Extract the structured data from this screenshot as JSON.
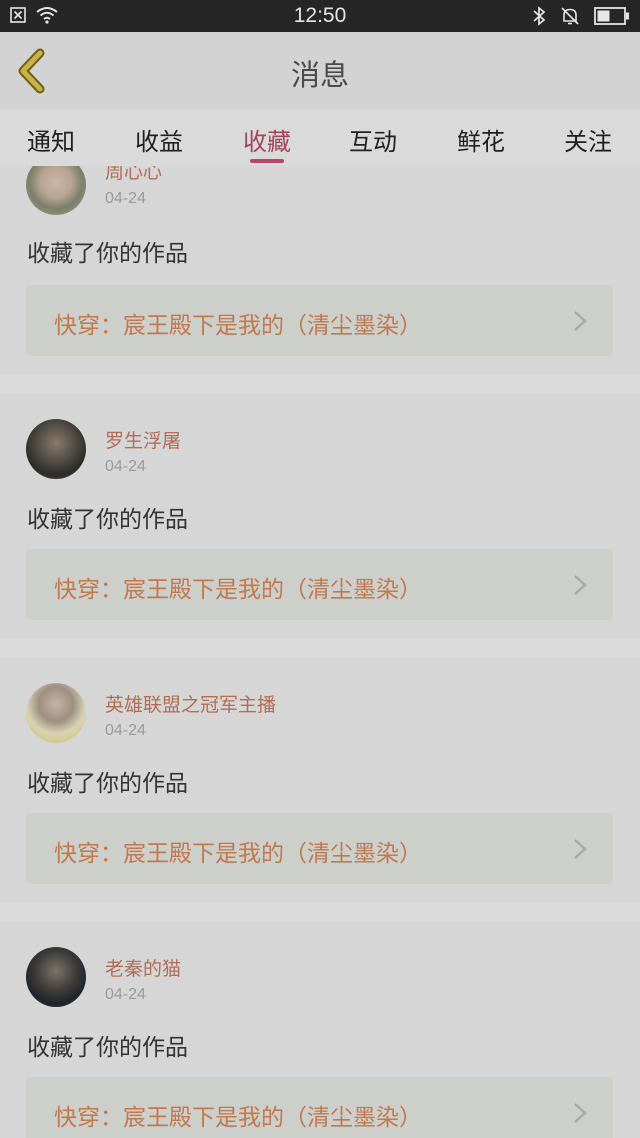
{
  "status_bar": {
    "time": "12:50"
  },
  "nav": {
    "title": "消息"
  },
  "tabs": [
    {
      "label": "通知"
    },
    {
      "label": "收益"
    },
    {
      "label": "收藏",
      "active": true
    },
    {
      "label": "互动"
    },
    {
      "label": "鲜花"
    },
    {
      "label": "关注"
    }
  ],
  "feed": [
    {
      "user": "周心心",
      "date": "04-24",
      "action": "收藏了你的作品",
      "work": "快穿：宸王殿下是我的（清尘墨染）"
    },
    {
      "user": "罗生浮屠",
      "date": "04-24",
      "action": "收藏了你的作品",
      "work": "快穿：宸王殿下是我的（清尘墨染）"
    },
    {
      "user": "英雄联盟之冠军主播",
      "date": "04-24",
      "action": "收藏了你的作品",
      "work": "快穿：宸王殿下是我的（清尘墨染）"
    },
    {
      "user": "老秦的猫",
      "date": "04-24",
      "action": "收藏了你的作品",
      "work": "快穿：宸王殿下是我的（清尘墨染）"
    }
  ],
  "colors": {
    "accent": "#b44a68",
    "username": "#b06e56",
    "work_title": "#c0794f",
    "overlay_background": "#dadada"
  },
  "icons": {
    "status_left": [
      "close-box-icon",
      "wifi-icon"
    ],
    "status_right": [
      "bluetooth-icon",
      "bell-muted-icon",
      "battery-icon"
    ],
    "nav": "back-arrow-icon",
    "row": "chevron-right-icon"
  }
}
